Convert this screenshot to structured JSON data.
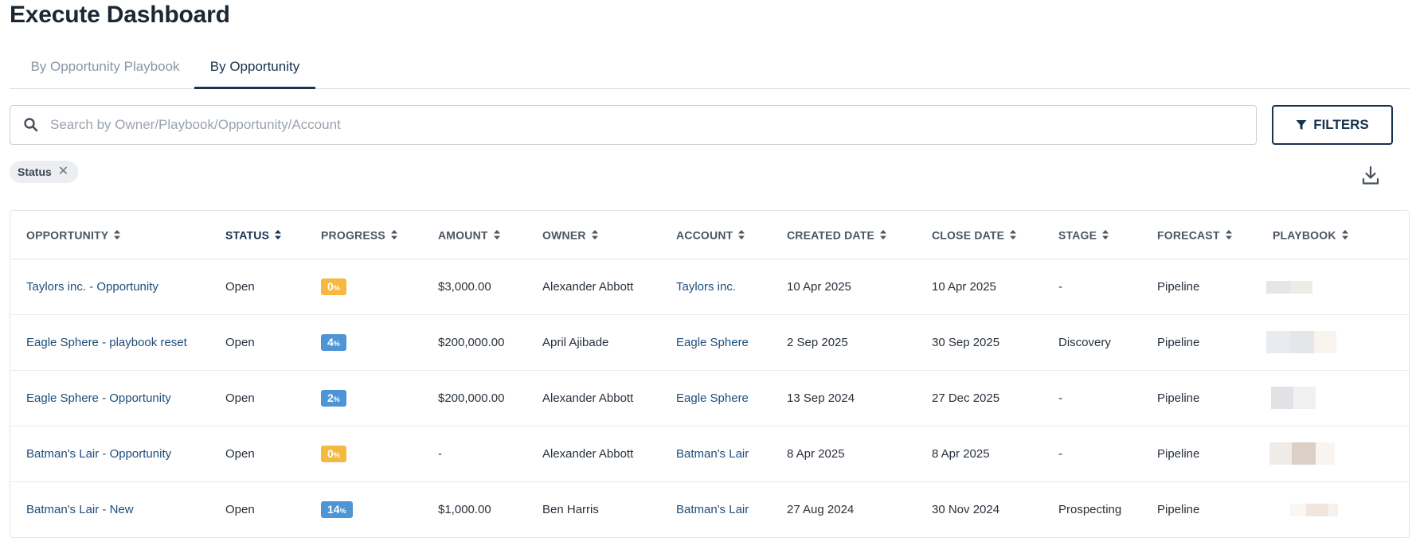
{
  "page": {
    "title": "Execute Dashboard"
  },
  "tabs": [
    {
      "label": "By Opportunity Playbook",
      "active": false
    },
    {
      "label": "By Opportunity",
      "active": true
    }
  ],
  "search": {
    "placeholder": "Search by Owner/Playbook/Opportunity/Account",
    "value": ""
  },
  "filters_button": {
    "label": "FILTERS",
    "icon": "filter-icon"
  },
  "active_filters": [
    {
      "label": "Status"
    }
  ],
  "download": {
    "icon": "download-icon"
  },
  "colors": {
    "accent": "#16324f",
    "link": "#1e4d7b",
    "badge_zero": "#f5b942",
    "badge_progress": "#4f94d4"
  },
  "table": {
    "columns": [
      {
        "key": "opportunity",
        "label": "OPPORTUNITY",
        "sorted": false
      },
      {
        "key": "status",
        "label": "STATUS",
        "sorted": true
      },
      {
        "key": "progress",
        "label": "PROGRESS",
        "sorted": false
      },
      {
        "key": "amount",
        "label": "AMOUNT",
        "sorted": false
      },
      {
        "key": "owner",
        "label": "OWNER",
        "sorted": false
      },
      {
        "key": "account",
        "label": "ACCOUNT",
        "sorted": false
      },
      {
        "key": "created_date",
        "label": "CREATED DATE",
        "sorted": false
      },
      {
        "key": "close_date",
        "label": "CLOSE DATE",
        "sorted": false
      },
      {
        "key": "stage",
        "label": "STAGE",
        "sorted": false
      },
      {
        "key": "forecast",
        "label": "FORECAST",
        "sorted": false
      },
      {
        "key": "playbook",
        "label": "PLAYBOOK",
        "sorted": false
      }
    ],
    "rows": [
      {
        "opportunity": "Taylors inc. - Opportunity",
        "status": "Open",
        "progress": 0,
        "amount": "$3,000.00",
        "owner": "Alexander Abbott",
        "account": "Taylors inc.",
        "created_date": "10 Apr 2025",
        "close_date": "10 Apr 2025",
        "stage": "-",
        "forecast": "Pipeline"
      },
      {
        "opportunity": "Eagle Sphere - playbook reset",
        "status": "Open",
        "progress": 4,
        "amount": "$200,000.00",
        "owner": "April Ajibade",
        "account": "Eagle Sphere",
        "created_date": "2 Sep 2025",
        "close_date": "30 Sep 2025",
        "stage": "Discovery",
        "forecast": "Pipeline"
      },
      {
        "opportunity": "Eagle Sphere - Opportunity",
        "status": "Open",
        "progress": 2,
        "amount": "$200,000.00",
        "owner": "Alexander Abbott",
        "account": "Eagle Sphere",
        "created_date": "13 Sep 2024",
        "close_date": "27 Dec 2025",
        "stage": "-",
        "forecast": "Pipeline"
      },
      {
        "opportunity": "Batman's Lair - Opportunity",
        "status": "Open",
        "progress": 0,
        "amount": "-",
        "owner": "Alexander Abbott",
        "account": "Batman's Lair",
        "created_date": "8 Apr 2025",
        "close_date": "8 Apr 2025",
        "stage": "-",
        "forecast": "Pipeline"
      },
      {
        "opportunity": "Batman's Lair - New",
        "status": "Open",
        "progress": 14,
        "amount": "$1,000.00",
        "owner": "Ben Harris",
        "account": "Batman's Lair",
        "created_date": "27 Aug 2024",
        "close_date": "30 Nov 2024",
        "stage": "Prospecting",
        "forecast": "Pipeline"
      }
    ]
  }
}
